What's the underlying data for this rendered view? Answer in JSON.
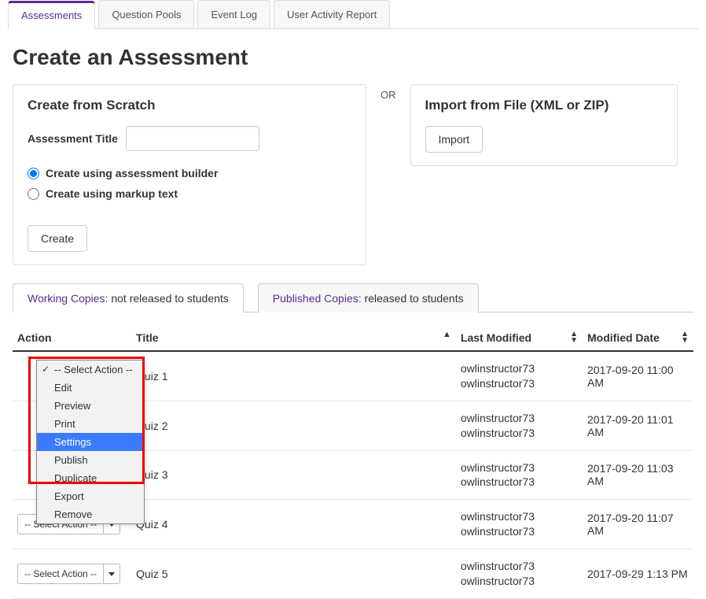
{
  "top_tabs": [
    "Assessments",
    "Question Pools",
    "Event Log",
    "User Activity Report"
  ],
  "active_top_tab": 0,
  "page_title": "Create an Assessment",
  "create_panel": {
    "title": "Create from Scratch",
    "field_label": "Assessment Title",
    "title_value": "",
    "radio_builder": "Create using assessment builder",
    "radio_markup": "Create using markup text",
    "selected_radio": "builder",
    "create_btn": "Create"
  },
  "or_label": "OR",
  "import_panel": {
    "title": "Import from File (XML or ZIP)",
    "import_btn": "Import"
  },
  "subtabs": {
    "working_label": "Working Copies:",
    "working_desc": " not released to students",
    "published_label": "Published Copies:",
    "published_desc": " released to students",
    "active": 0
  },
  "columns": {
    "action": "Action",
    "title": "Title",
    "last_modified": "Last Modified",
    "modified_date": "Modified Date"
  },
  "select_action_label": "-- Select Action --",
  "rows": [
    {
      "title": "Quiz 1",
      "lm1": "owlinstructor73",
      "lm2": "owlinstructor73",
      "date": "2017-09-20 11:00 AM"
    },
    {
      "title": "Quiz 2",
      "lm1": "owlinstructor73",
      "lm2": "owlinstructor73",
      "date": "2017-09-20 11:01 AM"
    },
    {
      "title": "Quiz 3",
      "lm1": "owlinstructor73",
      "lm2": "owlinstructor73",
      "date": "2017-09-20 11:03 AM"
    },
    {
      "title": "Quiz 4",
      "lm1": "owlinstructor73",
      "lm2": "owlinstructor73",
      "date": "2017-09-20 11:07 AM"
    },
    {
      "title": "Quiz 5",
      "lm1": "owlinstructor73",
      "lm2": "owlinstructor73",
      "date": "2017-09-29 1:13 PM"
    }
  ],
  "dropdown": {
    "options": [
      "-- Select Action --",
      "Edit",
      "Preview",
      "Print",
      "Settings",
      "Publish",
      "Duplicate",
      "Export",
      "Remove"
    ],
    "checked_index": 0,
    "highlighted_index": 4
  }
}
